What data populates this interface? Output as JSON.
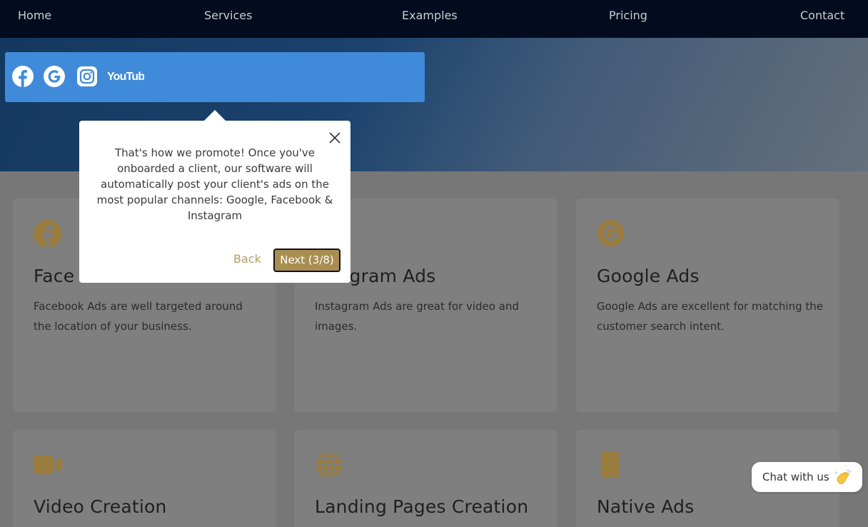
{
  "nav": {
    "items": [
      "Home",
      "Services",
      "Examples",
      "Pricing",
      "Contact"
    ]
  },
  "social_bar": {
    "icons": [
      "facebook-icon",
      "google-icon",
      "instagram-icon",
      "youtube-icon"
    ],
    "youtube_logo_text": "YouTube",
    "color": "#408bd9"
  },
  "tooltip": {
    "text": "That's how we promote! Once you've onboarded a client, our software will automatically post your client's ads on the most popular channels: Google, Facebook & Instagram",
    "back_label": "Back",
    "next_label": "Next (3/8)",
    "accent": "#a88e51"
  },
  "cards": [
    {
      "icon": "facebook-icon",
      "title": "Facebook Ads",
      "visible_title": "Face",
      "desc": "Facebook Ads are well targeted around the location of your business."
    },
    {
      "icon": "instagram-icon",
      "title": "Instagram Ads",
      "visible_title": "agram Ads",
      "desc": "Instagram Ads are great for video and images."
    },
    {
      "icon": "google-icon",
      "title": "Google Ads",
      "desc": "Google Ads are excellent for matching the customer search intent."
    },
    {
      "icon": "video-camera-icon",
      "title": "Video Creation"
    },
    {
      "icon": "globe-icon",
      "title": "Landing Pages Creation"
    },
    {
      "icon": "mobile-phone-icon",
      "title": "Native Ads"
    }
  ],
  "chat": {
    "label": "Chat with us",
    "emoji": "👋"
  },
  "colors": {
    "nav_bg": "#020c1e",
    "icon_gold": "#9a7c3e"
  }
}
